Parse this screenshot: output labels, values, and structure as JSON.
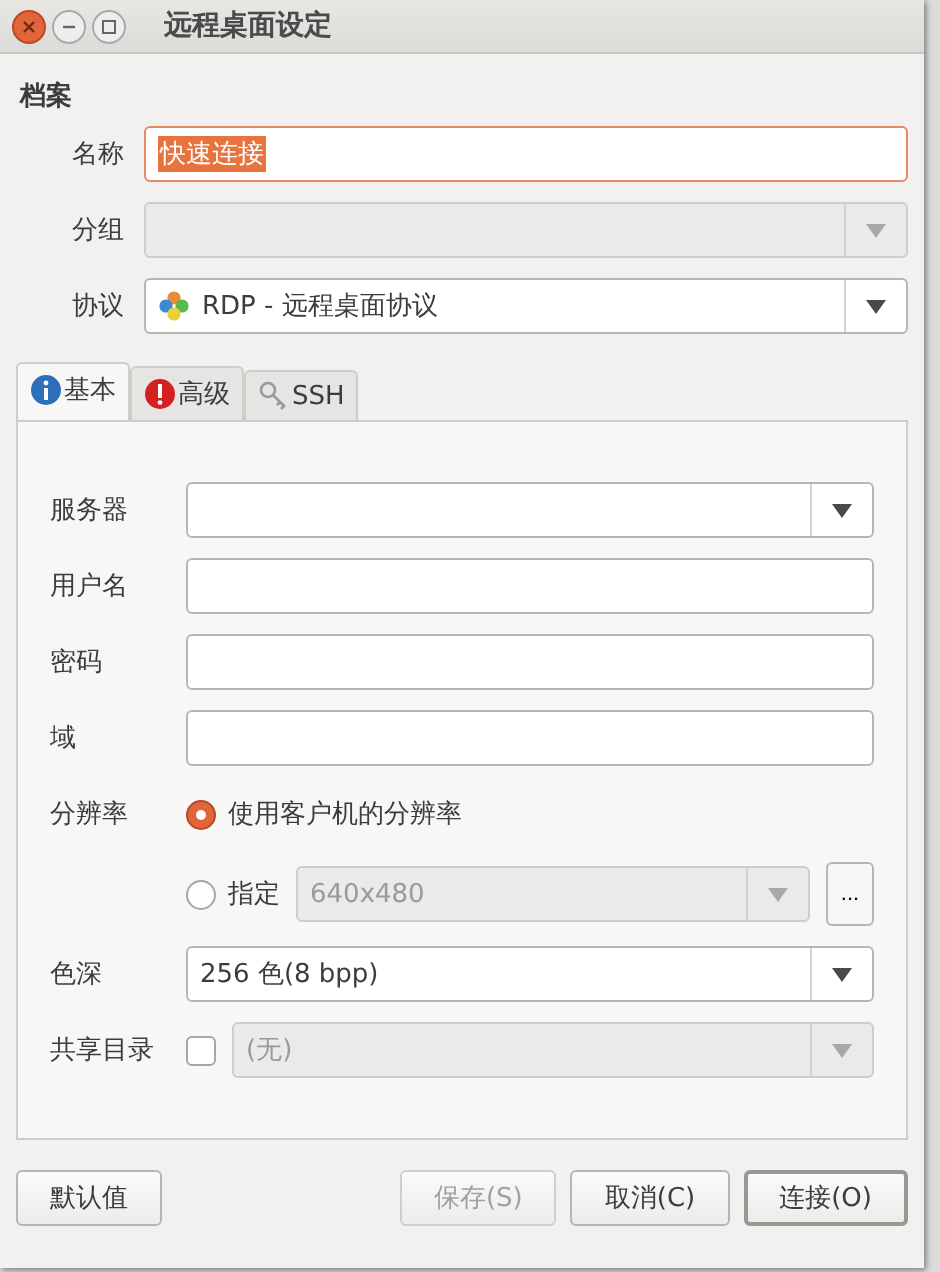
{
  "window": {
    "title": "远程桌面设定"
  },
  "profile": {
    "heading": "档案",
    "fields": [
      {
        "label": "名称",
        "kind": "text",
        "value": "快速连接",
        "highlighted": true,
        "focused": true
      },
      {
        "label": "分组",
        "kind": "combo",
        "disabled": true
      },
      {
        "label": "协议",
        "kind": "combo",
        "value": "RDP - 远程桌面协议",
        "with_icon": true
      }
    ]
  },
  "tabs": [
    {
      "label": "基本",
      "kind": "info",
      "selected": true
    },
    {
      "label": "高级",
      "kind": "warning",
      "selected": false
    },
    {
      "label": "SSH",
      "kind": "key",
      "selected": false
    }
  ],
  "basic": {
    "fields": [
      {
        "label": "服务器",
        "kind": "combo_entry"
      },
      {
        "label": "用户名",
        "kind": "text"
      },
      {
        "label": "密码",
        "kind": "text"
      },
      {
        "label": "域",
        "kind": "text"
      }
    ],
    "resolution": {
      "label": "分辨率",
      "options": [
        {
          "label": "使用客户机的分辨率",
          "selected": true
        },
        {
          "label": "指定",
          "selected": false,
          "value": "640x480",
          "disabled": true,
          "more": "..."
        }
      ]
    },
    "color_depth": {
      "label": "色深",
      "value": "256 色(8 bpp)"
    },
    "shared_folder": {
      "label": "共享目录",
      "checked": false,
      "value": "(无)",
      "disabled": true
    }
  },
  "left_buttons": [
    {
      "label": "默认值",
      "disabled": false,
      "default": false
    }
  ],
  "right_buttons": [
    {
      "label": "保存(S)",
      "disabled": true,
      "default": false
    },
    {
      "label": "取消(C)",
      "disabled": false,
      "default": false
    },
    {
      "label": "连接(O)",
      "disabled": false,
      "default": true
    }
  ]
}
